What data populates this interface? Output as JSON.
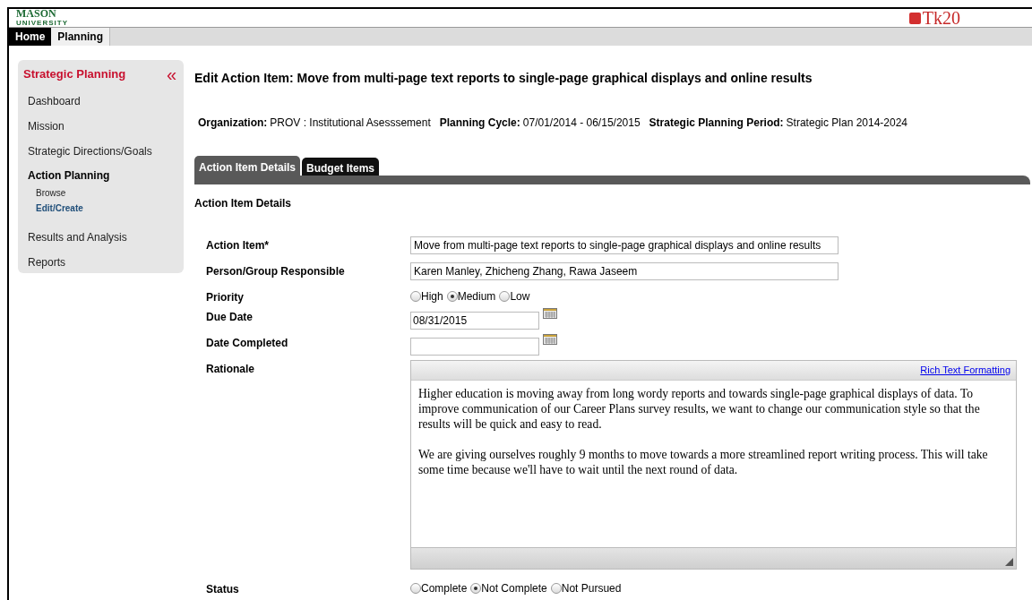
{
  "header": {
    "logo_main": "MASON",
    "logo_sub": "UNIVERSITY",
    "brand": "Tk20"
  },
  "top_tabs": [
    {
      "label": "Home",
      "selected": false
    },
    {
      "label": "Planning",
      "selected": true
    }
  ],
  "sidebar": {
    "title": "Strategic Planning",
    "collapse": "«",
    "items": [
      {
        "label": "Dashboard",
        "selected": false
      },
      {
        "label": "Mission",
        "selected": false
      },
      {
        "label": "Strategic Directions/Goals",
        "selected": false
      },
      {
        "label": "Action Planning",
        "selected": true,
        "children": [
          {
            "label": "Browse",
            "selected": false
          },
          {
            "label": "Edit/Create",
            "selected": true
          }
        ]
      },
      {
        "label": "Results and Analysis",
        "selected": false
      },
      {
        "label": "Reports",
        "selected": false
      }
    ]
  },
  "page_title": "Edit Action Item: Move from multi-page text reports to single-page graphical displays and online results",
  "info": [
    {
      "label": "Organization:",
      "value": "PROV : Institutional Asesssement"
    },
    {
      "label": "Planning Cycle:",
      "value": "07/01/2014 - 06/15/2015"
    },
    {
      "label": "Strategic Planning Period:",
      "value": "Strategic Plan 2014-2024"
    }
  ],
  "tabs": [
    {
      "label": "Action Item Details",
      "selected": true
    },
    {
      "label": "Budget Items",
      "selected": false
    }
  ],
  "section_title": "Action Item Details",
  "fields": [
    {
      "kind": "text",
      "label": "Action Item*",
      "value": "Move from multi-page text reports to single-page graphical displays and online results"
    },
    {
      "kind": "text",
      "label": "Person/Group Responsible",
      "value": "Karen Manley, Zhicheng Zhang, Rawa Jaseem"
    },
    {
      "kind": "radio",
      "label": "Priority",
      "options": [
        {
          "label": "High",
          "selected": false
        },
        {
          "label": "Medium",
          "selected": true
        },
        {
          "label": "Low",
          "selected": false
        }
      ]
    },
    {
      "kind": "date",
      "label": "Due Date",
      "value": "08/31/2015"
    },
    {
      "kind": "date",
      "label": "Date Completed"
    },
    {
      "kind": "richtext",
      "label": "Rationale",
      "link": "Rich Text Formatting",
      "paragraphs": [
        "Higher education is moving away from long wordy reports and towards single-page graphical displays of data. To improve communication of our Career Plans survey results, we want to change our communication style so that the results will be quick and easy to read.",
        "We are giving ourselves roughly 9 months to move towards a more streamlined report writing process. This will take some time because we'll have to wait until the next round of data."
      ]
    },
    {
      "kind": "radio",
      "label": "Status",
      "options": [
        {
          "label": "Complete",
          "selected": false
        },
        {
          "label": "Not Complete",
          "selected": true
        },
        {
          "label": "Not Pursued",
          "selected": false
        }
      ]
    }
  ]
}
